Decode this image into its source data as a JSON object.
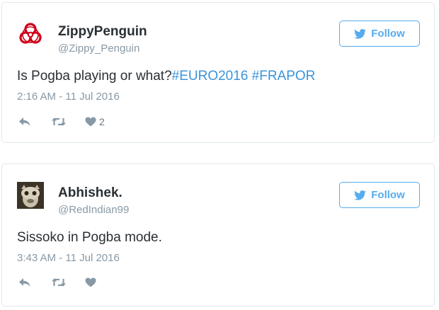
{
  "tweets": [
    {
      "name": "ZippyPenguin",
      "handle": "@Zippy_Penguin",
      "follow_label": "Follow",
      "text_plain": "Is Pogba playing or what?",
      "hashtags": [
        "#EURO2016",
        "#FRAPOR"
      ],
      "timestamp": "2:16 AM - 11 Jul 2016",
      "like_count": "2",
      "avatar": "biohazard-icon"
    },
    {
      "name": "Abhishek.",
      "handle": "@RedIndian99",
      "follow_label": "Follow",
      "text_plain": "Sissoko in Pogba mode.",
      "hashtags": [],
      "timestamp": "3:43 AM - 11 Jul 2016",
      "like_count": "",
      "avatar": "profile-photo"
    }
  ],
  "colors": {
    "accent": "#55acee",
    "hashtag": "#3b94d9",
    "muted": "#8899a6",
    "text": "#292f33",
    "border": "#e1e8ed",
    "biohazard": "#d0021b"
  }
}
